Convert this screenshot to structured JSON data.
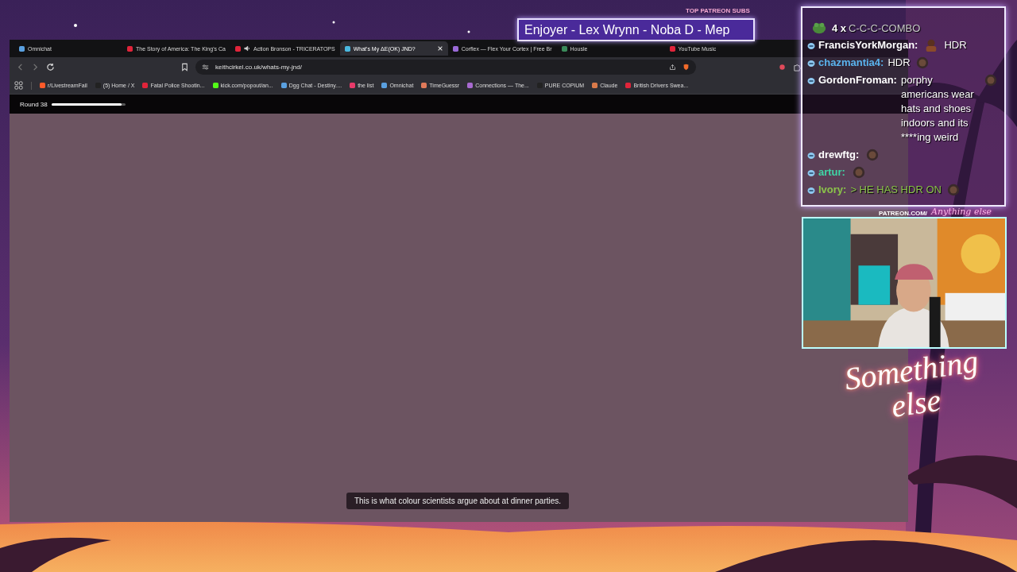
{
  "stream": {
    "subs_label": "TOP PATREON SUBS",
    "subs_ticker": "Enjoyer - Lex Wrynn -  Noba D - Mep",
    "chat": {
      "combo": {
        "count": "4 x",
        "text": "C-C-C-COMBO"
      },
      "messages": [
        {
          "user": "FrancisYorkMorgan:",
          "text": "HDR"
        },
        {
          "user": "chazmantia4:",
          "color": "#5ab4ee",
          "text": "HDR"
        },
        {
          "user": "GordonFroman:",
          "text": "porphy americans wear hats and shoes indoors and its ****ing weird"
        },
        {
          "user": "drewftg:"
        },
        {
          "user": "artur:",
          "color": "#3fd6a6"
        },
        {
          "user": "Ivory:",
          "color": "#8bc34a",
          "text": "> HE HAS HDR ON",
          "greentext": true
        }
      ]
    },
    "patreon_label": "PATREON.COM/",
    "patreon_name": "Anything else",
    "logo": "Something else"
  },
  "browser": {
    "tabs": [
      {
        "title": "Omnichat",
        "selected": false,
        "audio": false
      },
      {
        "title": "The Story of America: The King's Ca",
        "selected": false,
        "audio": false
      },
      {
        "title": "Action Bronson - TRICERATOPS",
        "selected": false,
        "audio": true
      },
      {
        "title": "What's My ΔE(OK) JND?",
        "selected": true,
        "audio": false
      },
      {
        "title": "Corflex — Flex Your Cortex | Free Br",
        "selected": false,
        "audio": false
      },
      {
        "title": "Housle",
        "selected": false,
        "audio": false
      },
      {
        "title": "YouTube Music",
        "selected": false,
        "audio": false
      }
    ],
    "url": "keithcirkel.co.uk/whats-my-jnd/",
    "bookmarks": [
      "r/LivestreamFail",
      "(5) Home / X",
      "Fatal Police Shootin...",
      "kick.com/popout/an...",
      "Dgg Chat - Destiny....",
      "the list",
      "Omnichat",
      "TimeGuessr",
      "Connections — The...",
      "PURE  COPIUM",
      "Claude",
      "British Drivers Swea..."
    ],
    "page": {
      "round": "Round 38",
      "level": 0.95,
      "toast": "This is what colour scientists argue about at dinner parties."
    }
  }
}
